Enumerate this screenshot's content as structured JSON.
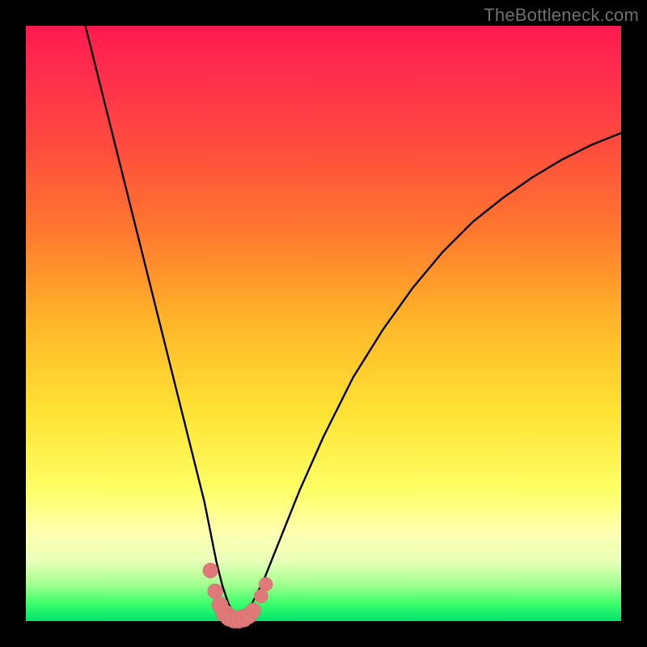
{
  "watermark": {
    "text": "TheBottleneck.com"
  },
  "colors": {
    "curve": "#000000",
    "marker_fill": "#e07a7a",
    "marker_stroke": "#c96666",
    "background_black": "#000000"
  },
  "chart_data": {
    "type": "line",
    "title": "",
    "xlabel": "",
    "ylabel": "",
    "xlim": [
      0,
      100
    ],
    "ylim": [
      0,
      100
    ],
    "grid": false,
    "legend": false,
    "series": [
      {
        "name": "bottleneck-curve",
        "x": [
          10,
          12,
          14,
          16,
          18,
          20,
          22,
          24,
          26,
          28,
          30,
          31,
          32,
          33,
          34,
          35,
          36,
          37,
          38,
          40,
          42,
          44,
          46,
          50,
          55,
          60,
          65,
          70,
          75,
          80,
          85,
          90,
          95,
          100
        ],
        "y": [
          100,
          92,
          84,
          76,
          68,
          60,
          52,
          44,
          36,
          28,
          20,
          15,
          10,
          6,
          3,
          1,
          0.3,
          1,
          3,
          7,
          12,
          17,
          22,
          31,
          41,
          49,
          56,
          62,
          67,
          71,
          74.5,
          77.5,
          80,
          82
        ]
      }
    ],
    "markers": {
      "name": "highlight-band",
      "x": [
        31.0,
        31.8,
        32.6,
        33.4,
        34.2,
        35.0,
        35.8,
        36.6,
        37.4,
        38.2,
        39.5,
        40.3
      ],
      "y": [
        8.5,
        5.0,
        2.7,
        1.3,
        0.6,
        0.3,
        0.3,
        0.5,
        0.9,
        1.8,
        4.2,
        6.2
      ],
      "radius": [
        1.1,
        1.1,
        1.2,
        1.3,
        1.3,
        1.3,
        1.3,
        1.3,
        1.2,
        1.1,
        1.0,
        1.0
      ]
    }
  }
}
